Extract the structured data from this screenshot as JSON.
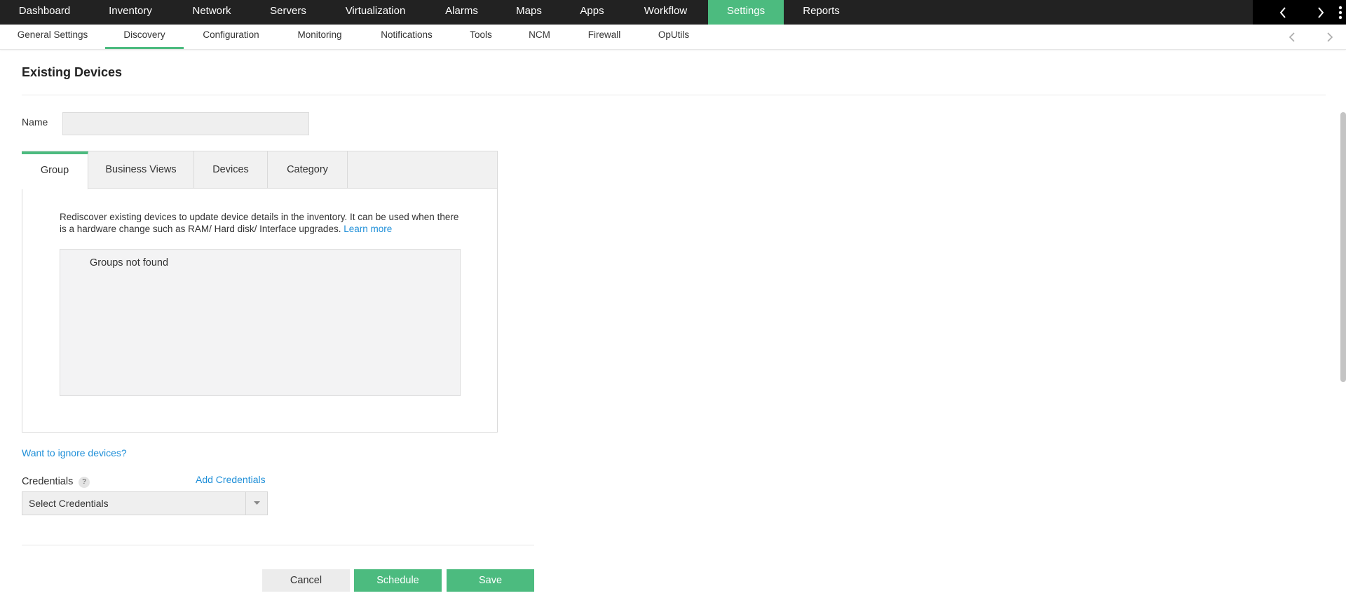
{
  "topnav": {
    "items": [
      {
        "label": "Dashboard"
      },
      {
        "label": "Inventory"
      },
      {
        "label": "Network"
      },
      {
        "label": "Servers"
      },
      {
        "label": "Virtualization"
      },
      {
        "label": "Alarms"
      },
      {
        "label": "Maps"
      },
      {
        "label": "Apps"
      },
      {
        "label": "Workflow"
      },
      {
        "label": "Settings",
        "active": true
      },
      {
        "label": "Reports"
      }
    ]
  },
  "subnav": {
    "items": [
      {
        "label": "General Settings"
      },
      {
        "label": "Discovery",
        "active": true
      },
      {
        "label": "Configuration"
      },
      {
        "label": "Monitoring"
      },
      {
        "label": "Notifications"
      },
      {
        "label": "Tools"
      },
      {
        "label": "NCM"
      },
      {
        "label": "Firewall"
      },
      {
        "label": "OpUtils"
      }
    ]
  },
  "page": {
    "title": "Existing Devices",
    "name_label": "Name",
    "name_value": ""
  },
  "tabs": [
    {
      "label": "Group",
      "active": true
    },
    {
      "label": "Business Views"
    },
    {
      "label": "Devices"
    },
    {
      "label": "Category"
    }
  ],
  "group_panel": {
    "description": "Rediscover existing devices to update device details in the inventory. It can be used when there is a hardware change such as RAM/ Hard disk/ Interface upgrades.",
    "learn_more": "Learn more",
    "empty_text": "Groups not found"
  },
  "ignore_link": "Want to ignore devices?",
  "credentials": {
    "label": "Credentials",
    "help": "?",
    "add_link": "Add Credentials",
    "selected": "Select Credentials"
  },
  "buttons": {
    "cancel": "Cancel",
    "schedule": "Schedule",
    "save": "Save"
  },
  "colors": {
    "accent": "#4cbb7f",
    "link": "#1f8fd8",
    "topbar": "#222222"
  }
}
